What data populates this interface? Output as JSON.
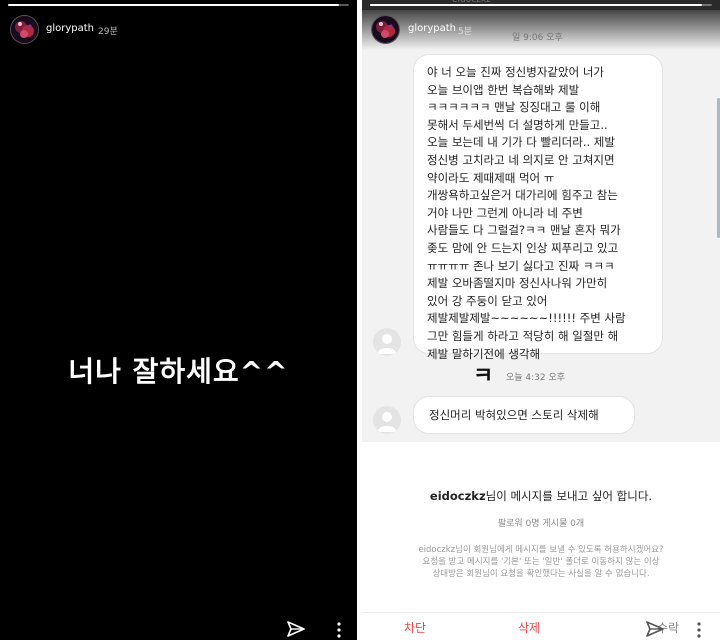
{
  "story_left": {
    "username": "glorypath",
    "time": "29분",
    "progress": 0.97,
    "main_text": "너나 잘하세요^^",
    "icons": {
      "send": "send-icon",
      "more": "more-dots-icon"
    }
  },
  "story_right": {
    "username": "glorypath",
    "time": "5분",
    "top_cut_text": "eidoczkz",
    "progress": 0.97
  },
  "dm": {
    "timestamp_1": "일 9:06 오후",
    "message_1_lines": [
      "야 너 오늘 진짜 정신병자같았어 너가",
      "오늘 브이앱 한번 복습해봐 제발",
      "ㅋㅋㅋㅋㅋㅋ 맨날 징징대고 룰 이해",
      "못해서 두세번씩 더 설명하게 만들고..",
      "오늘 보는데 내 기가 다 빨리더라.. 제발",
      "정신병 고치라고 네 의지로 안 고쳐지면",
      "약이라도 제때제때 먹어 ㅠ",
      "개쌍욕하고싶은거 대가리에 힘주고 참는",
      "거야 나만 그런게 아니라 네 주변",
      "사람들도 다 그럴걸?ㅋㅋ 맨날 혼자 뭐가",
      "좆도 맘에 안 드는지 인상 찌푸리고 있고",
      "ㅠㅠㅠㅠ 존나 보기 싫다고 진짜 ㅋㅋㅋ",
      "제발 오바좀떨지마 정신사나워 가만히",
      "있어 강 주둥이 닫고 있어",
      "제발제발제발~~~~~~!!!!!! 주변 사람",
      "그만 힘들게 하라고 적당히 해 일절만 해",
      "제발 말하기전에 생각해"
    ],
    "sent_char": "ㅋ",
    "timestamp_2": "오늘 4:32 오후",
    "message_2": "정신머리 박혀있으면 스토리 삭제해"
  },
  "request": {
    "username": "eidoczkz",
    "title_rest": "님이 메시지를 보내고 싶어 합니다.",
    "sub": "팔로워 0명 게시물 0개",
    "notice_lines": [
      "eidoczkz님이 회원님에게 메시지를 보낼 수 있도록 허용하시겠어요?",
      "요청을 받고 메시지를 '기본' 또는 '일반' 폴더로 이동하지 않는 이상",
      "상대방은 회원님이 요청을 확인했다는 사실을 알 수 없습니다."
    ],
    "actions": {
      "block": "차단",
      "delete": "삭제",
      "accept": "수락"
    }
  },
  "colors": {
    "story_bg": "#000000",
    "dm_bg": "#f2f2f2",
    "bubble_bg": "#ffffff",
    "danger": "#e84a4a"
  }
}
